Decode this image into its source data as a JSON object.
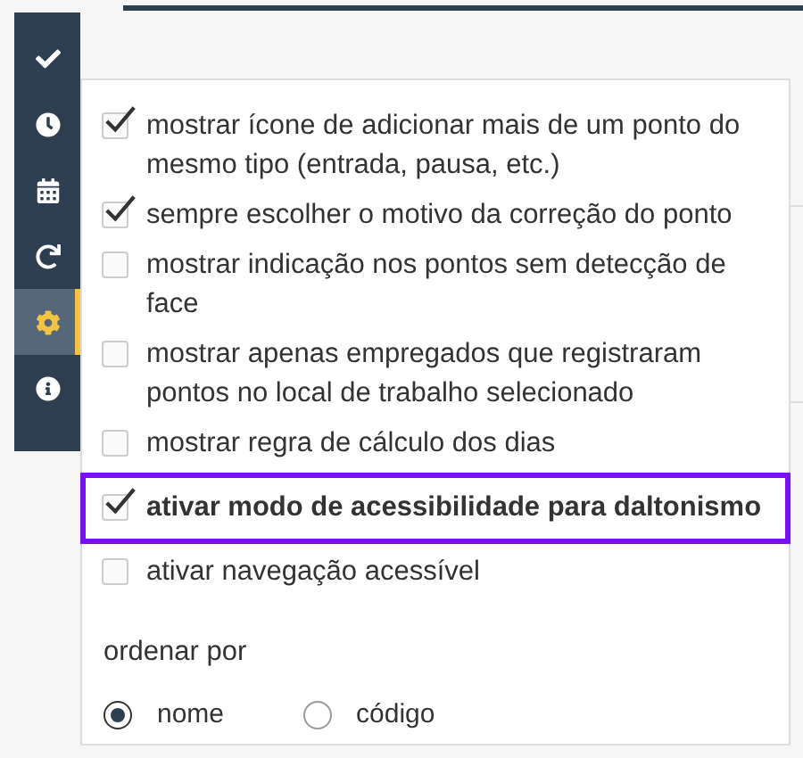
{
  "sidebar": {
    "items": [
      {
        "kind": "check",
        "selected": false
      },
      {
        "kind": "clock",
        "selected": false
      },
      {
        "kind": "calendar",
        "selected": false
      },
      {
        "kind": "refresh",
        "selected": false
      },
      {
        "kind": "settings",
        "selected": true
      },
      {
        "kind": "info",
        "selected": false
      }
    ]
  },
  "options": [
    {
      "label": "mostrar ícone de adicionar mais de um ponto do mesmo tipo (entrada, pausa, etc.)",
      "checked": true,
      "highlighted": false
    },
    {
      "label": "sempre escolher o motivo da correção do ponto",
      "checked": true,
      "highlighted": false
    },
    {
      "label": "mostrar indicação nos pontos sem detecção de face",
      "checked": false,
      "highlighted": false
    },
    {
      "label": "mostrar apenas empregados que registraram pontos no local de trabalho selecionado",
      "checked": false,
      "highlighted": false
    },
    {
      "label": "mostrar regra de cálculo dos dias",
      "checked": false,
      "highlighted": false
    },
    {
      "label": "ativar modo de acessibilidade para daltonismo",
      "checked": true,
      "highlighted": true
    },
    {
      "label": "ativar navegação acessível",
      "checked": false,
      "highlighted": false
    }
  ],
  "sort": {
    "label": "ordenar por",
    "options": [
      {
        "label": "nome",
        "selected": true
      },
      {
        "label": "código",
        "selected": false
      }
    ]
  }
}
